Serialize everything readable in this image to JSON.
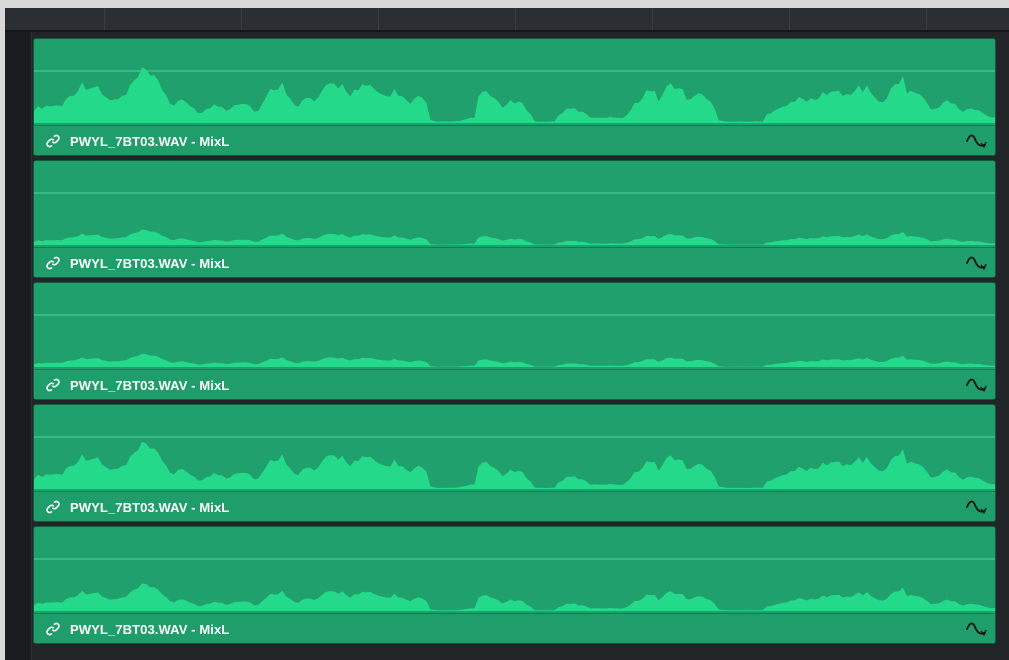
{
  "timeline": {
    "clips": [
      {
        "label": "PWYL_7BT03.WAV - MixL",
        "gain": 1.0,
        "link_icon": "link-icon",
        "curve_icon": "fade-curve-icon"
      },
      {
        "label": "PWYL_7BT03.WAV - MixL",
        "gain": 0.28,
        "link_icon": "link-icon",
        "curve_icon": "fade-curve-icon"
      },
      {
        "label": "PWYL_7BT03.WAV - MixL",
        "gain": 0.24,
        "link_icon": "link-icon",
        "curve_icon": "fade-curve-icon"
      },
      {
        "label": "PWYL_7BT03.WAV - MixL",
        "gain": 0.85,
        "link_icon": "link-icon",
        "curve_icon": "fade-curve-icon"
      },
      {
        "label": "PWYL_7BT03.WAV - MixL",
        "gain": 0.5,
        "link_icon": "link-icon",
        "curve_icon": "fade-curve-icon"
      }
    ]
  },
  "colors": {
    "clip_body": "#1fa06d",
    "waveform": "#25d98a",
    "clip_border": "#0f5c3e",
    "background": "#1d2023"
  }
}
